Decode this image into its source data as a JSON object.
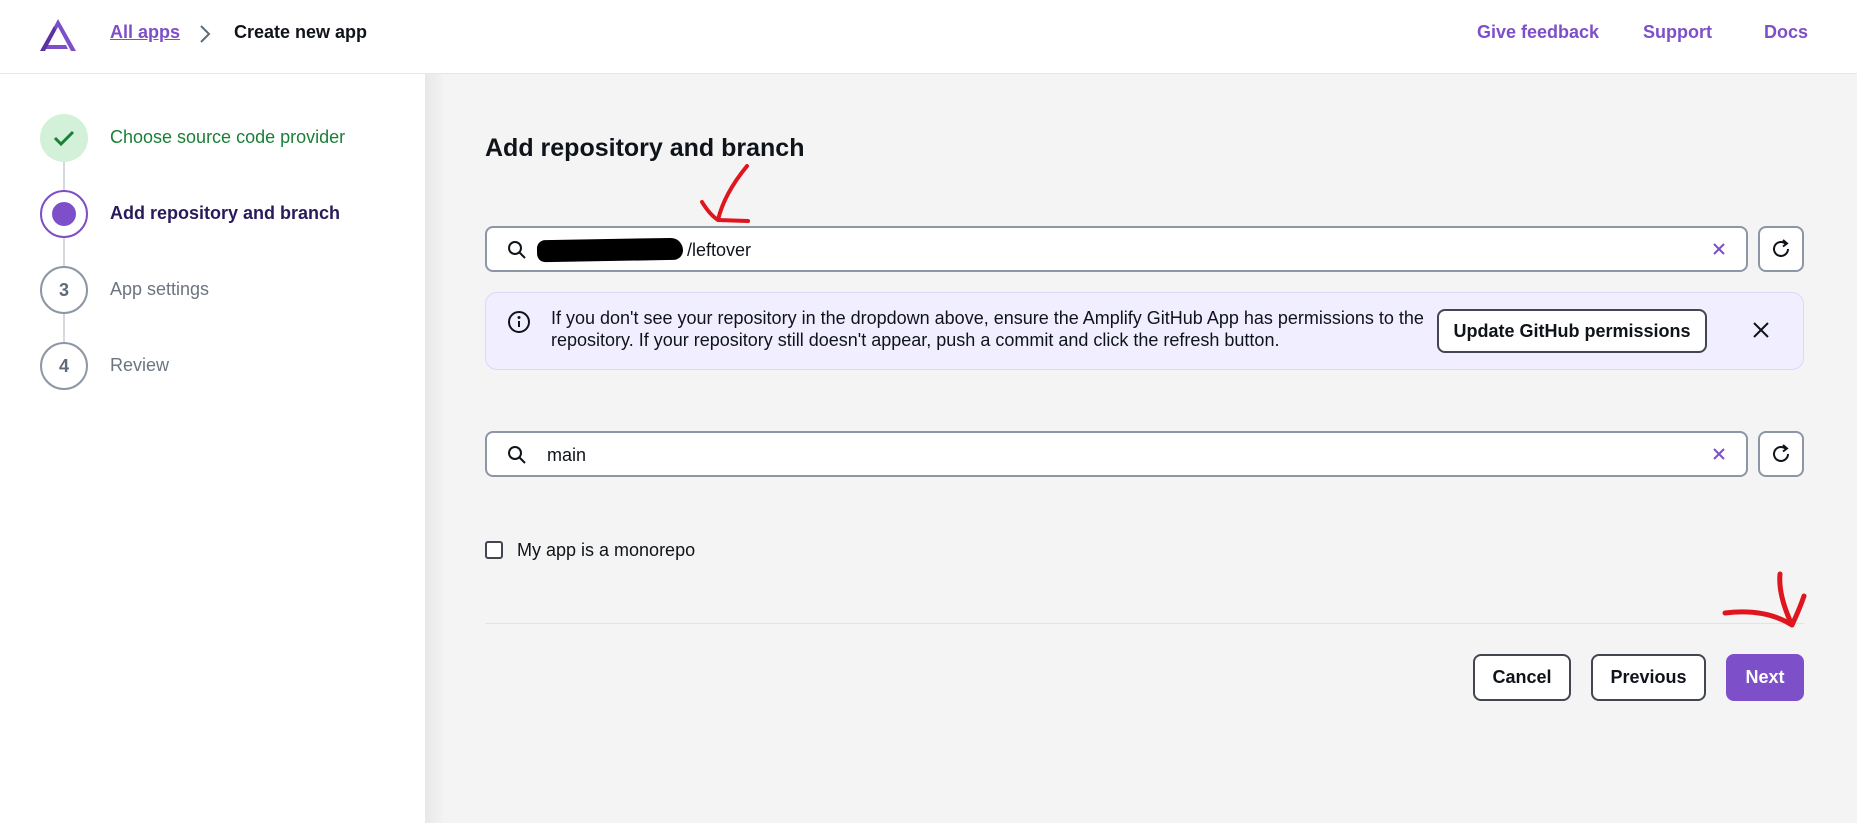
{
  "header": {
    "breadcrumb_link": "All apps",
    "breadcrumb_current": "Create new app",
    "links": [
      "Give feedback",
      "Support",
      "Docs"
    ]
  },
  "steps": [
    {
      "number": "",
      "label": "Choose source code provider",
      "state": "done"
    },
    {
      "number": "",
      "label": "Add repository and branch",
      "state": "active"
    },
    {
      "number": "3",
      "label": "App settings",
      "state": "pending"
    },
    {
      "number": "4",
      "label": "Review",
      "state": "pending"
    }
  ],
  "main": {
    "title": "Add repository and branch",
    "repository": {
      "value": "/leftover"
    },
    "info": {
      "text": "If you don't see your repository in the dropdown above, ensure the Amplify GitHub App has permissions to the repository. If your repository still doesn't appear, push a commit and click the refresh button.",
      "button": "Update GitHub permissions"
    },
    "branch": {
      "value": "main"
    },
    "monorepo_label": "My app is a monorepo",
    "buttons": {
      "cancel": "Cancel",
      "previous": "Previous",
      "next": "Next"
    }
  },
  "colors": {
    "accent": "#7d4fc8",
    "success": "#1a7f37",
    "annotation": "#e0161e"
  },
  "icons": [
    "amplify-logo-icon",
    "chevron-right-icon",
    "check-icon",
    "search-icon",
    "clear-icon",
    "refresh-icon",
    "info-icon",
    "close-icon"
  ]
}
